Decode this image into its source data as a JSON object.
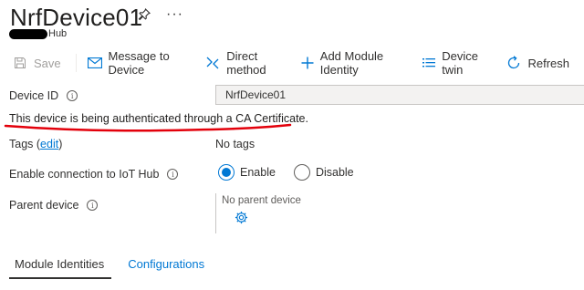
{
  "header": {
    "title": "NrfDevice01",
    "subtitle_suffix": "Hub",
    "more_label": "···"
  },
  "toolbar": {
    "save_label": "Save",
    "message_label": "Message to Device",
    "direct_method_label": "Direct method",
    "add_module_label": "Add Module Identity",
    "device_twin_label": "Device twin",
    "refresh_label": "Refresh"
  },
  "fields": {
    "device_id_label": "Device ID",
    "device_id_value": "NrfDevice01",
    "auth_note": "This device is being authenticated through a CA Certificate.",
    "tags_label": "Tags (",
    "tags_link": "edit",
    "tags_label_close": ")",
    "tags_value": "No tags",
    "connection_label": "Enable connection to IoT Hub",
    "enable_label": "Enable",
    "disable_label": "Disable",
    "connection_selected": "Enable",
    "parent_label": "Parent device",
    "parent_value": "No parent device"
  },
  "tabs": [
    {
      "label": "Module Identities",
      "active": true
    },
    {
      "label": "Configurations",
      "active": false
    }
  ],
  "icons": {
    "pin": "pin-icon",
    "more": "ellipsis-icon",
    "save": "save-icon",
    "message": "envelope-icon",
    "direct_method": "direct-method-icon",
    "add": "plus-icon",
    "twin": "list-icon",
    "refresh": "refresh-icon",
    "info": "info-icon",
    "gear": "gear-icon"
  },
  "colors": {
    "accent": "#0078d4",
    "annotation": "#e3000b",
    "disabled": "#a19f9d"
  }
}
